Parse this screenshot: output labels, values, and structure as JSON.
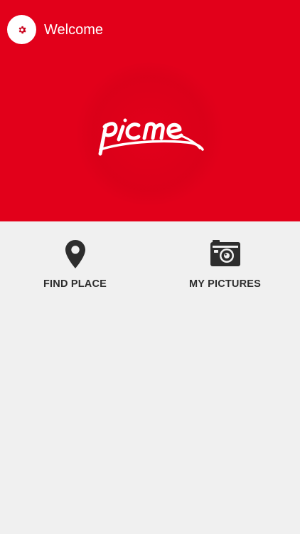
{
  "header": {
    "title": "Welcome",
    "settings_icon": "gear-icon"
  },
  "brand": {
    "logo_text": "picme",
    "primary_color": "#e2001a"
  },
  "actions": [
    {
      "label": "FIND PLACE",
      "icon": "map-pin-icon"
    },
    {
      "label": "MY PICTURES",
      "icon": "camera-icon"
    }
  ]
}
